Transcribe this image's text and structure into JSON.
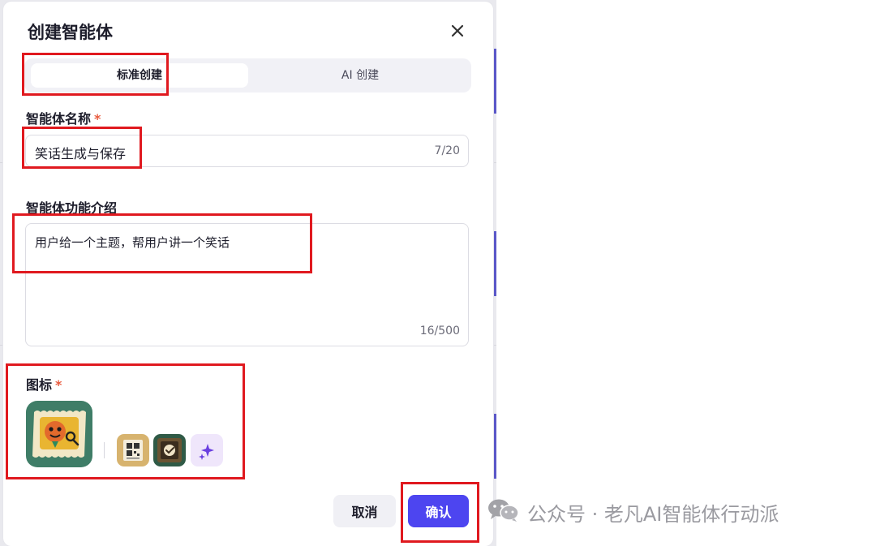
{
  "dialog": {
    "title": "创建智能体",
    "close_icon": "close-icon"
  },
  "tabs": [
    {
      "label": "标准创建",
      "active": true
    },
    {
      "label": "AI 创建",
      "active": false
    }
  ],
  "name_field": {
    "label": "智能体名称",
    "required_mark": "*",
    "value": "笑话生成与保存",
    "counter": "7/20"
  },
  "desc_field": {
    "label": "智能体功能介绍",
    "value": "用户给一个主题，帮用户讲一个笑话",
    "counter": "16/500"
  },
  "icon_field": {
    "label": "图标",
    "required_mark": "*",
    "selected_icon": "emoji-face-icon",
    "options": [
      "qr-card-icon",
      "checkmark-badge-icon",
      "sparkle-icon"
    ]
  },
  "actions": {
    "cancel_label": "取消",
    "confirm_label": "确认"
  },
  "watermark": {
    "text": "公众号 · 老凡AI智能体行动派"
  },
  "colors": {
    "primary": "#4d45f0",
    "highlight": "#e0191f",
    "required": "#e85b3f"
  }
}
